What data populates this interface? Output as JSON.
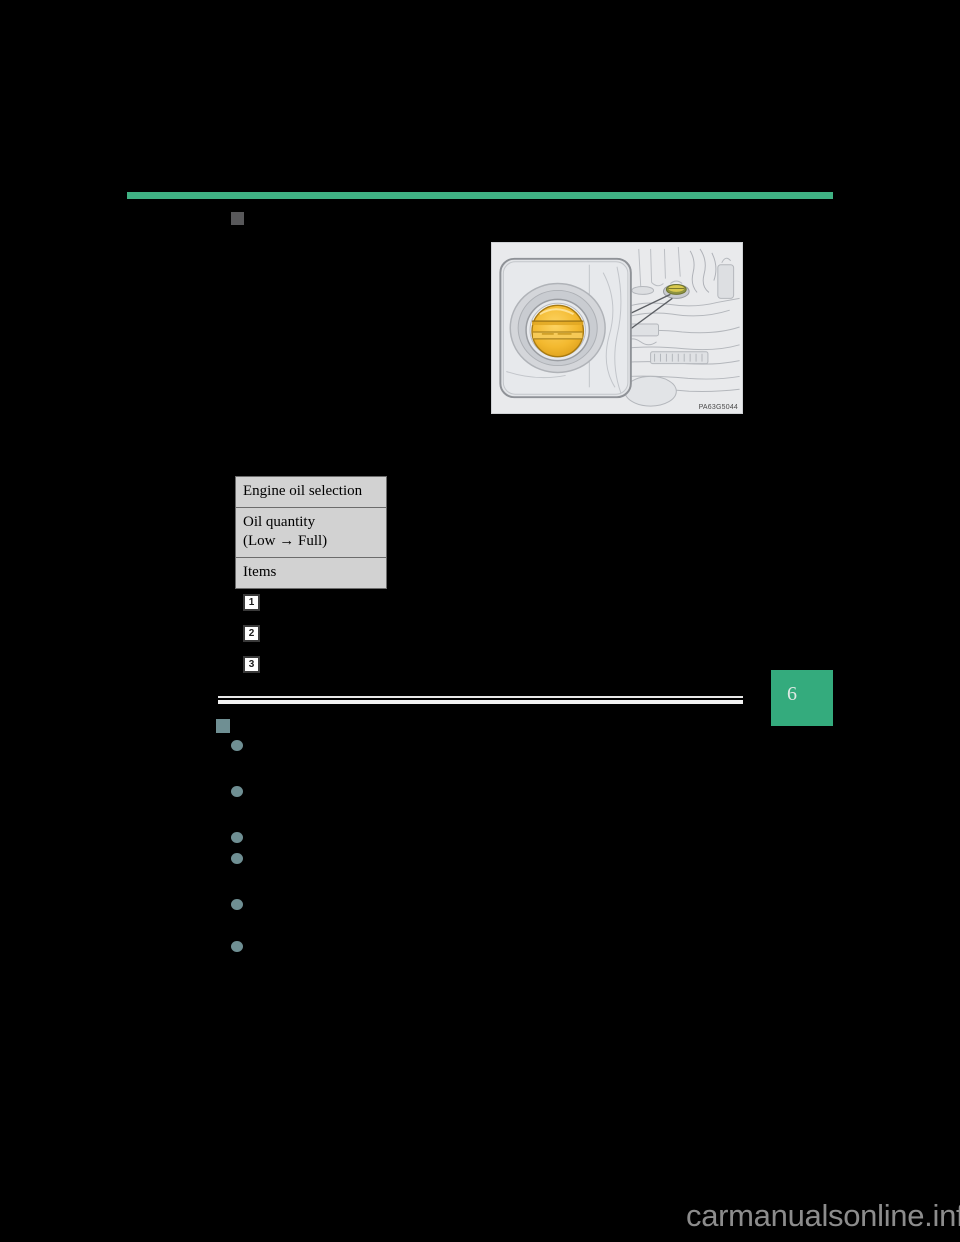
{
  "page": {
    "background_color": "#000000",
    "chapter_tab": {
      "number": "6",
      "color": "#34ab7d"
    },
    "header_rule_color": "#3fb183",
    "watermark": "carmanualsonline.info"
  },
  "section_upper": {
    "marker": "square-marker",
    "marker_color": "#58585a"
  },
  "illustration": {
    "id_label": "PA63G5044",
    "background_color": "#e9eaec",
    "cap_color": "#f0b52a",
    "description": "engine-oil-filler-cap"
  },
  "table": {
    "rows": [
      {
        "label": "Engine oil selection"
      },
      {
        "label": "Oil quantity\n(Low → Full)"
      },
      {
        "label": "Items"
      }
    ]
  },
  "callouts": [
    {
      "number": "1"
    },
    {
      "number": "2"
    },
    {
      "number": "3"
    }
  ],
  "section_lower": {
    "marker": "square-marker",
    "marker_color": "#6f8f93",
    "bullet_color": "#6f8f93",
    "bullets": [
      {
        "id": "bullet-1"
      },
      {
        "id": "bullet-2"
      },
      {
        "id": "bullet-3"
      },
      {
        "id": "bullet-4"
      },
      {
        "id": "bullet-5"
      },
      {
        "id": "bullet-6"
      }
    ]
  }
}
